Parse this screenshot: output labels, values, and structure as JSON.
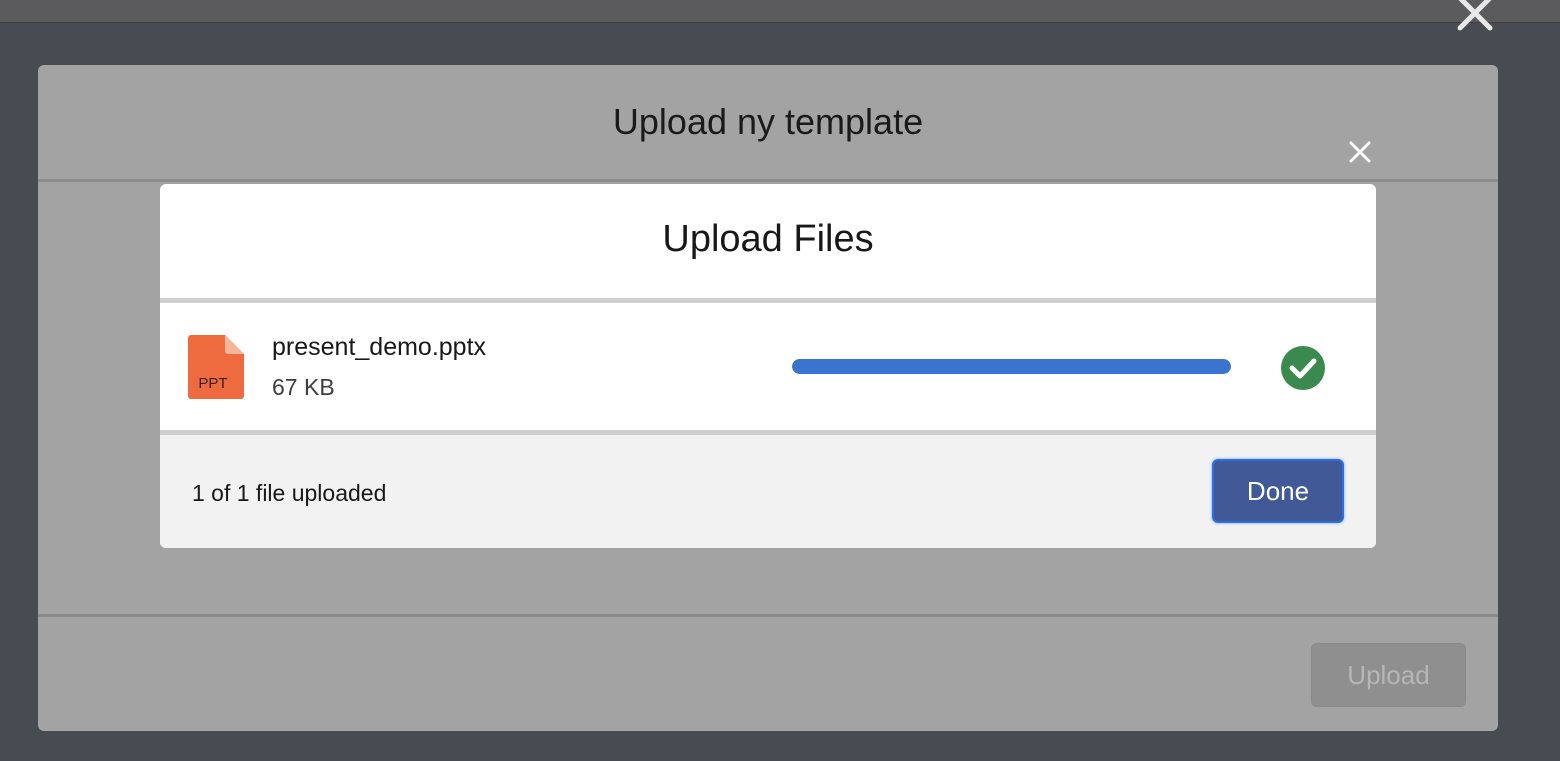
{
  "outer_modal": {
    "title": "Upload ny template",
    "upload_label": "Upload"
  },
  "upload_dialog": {
    "title": "Upload Files",
    "file": {
      "name": "present_demo.pptx",
      "size": "67 KB",
      "type_label": "PPT",
      "icon": "ppt-file-icon",
      "progress": 1.0
    },
    "status_text": "1 of 1 file uploaded",
    "done_label": "Done"
  },
  "icons": {
    "outer_close": "close-icon",
    "inner_close": "close-icon",
    "success": "check-circle-icon"
  },
  "colors": {
    "backdrop": "#484b52",
    "outer_modal": "#a3a3a3",
    "progress": "#3b74cf",
    "success": "#3a8a4f",
    "done_button": "#415a97",
    "ppt_icon": "#ed6b3e"
  }
}
